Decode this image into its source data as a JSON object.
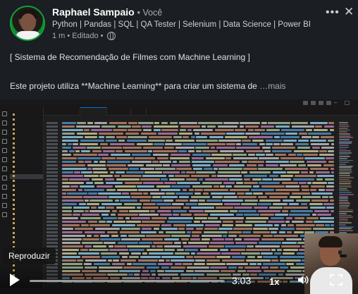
{
  "post": {
    "author_name": "Raphael Sampaio",
    "author_tag": "• Você",
    "headline": "Python | Pandas | SQL | QA Tester | Selenium | Data Science | Power BI",
    "time_edited": "1 m • Editado •",
    "text_line1": "[ Sistema de Recomendação de Filmes com Machine Learning ]",
    "text_line2": "Este projeto utiliza **Machine Learning** para criar um sistema de",
    "see_more": "…mais"
  },
  "icons": {
    "more": "more-icon",
    "close": "close-icon",
    "visibility": "globe-icon",
    "play": "play-icon",
    "volume": "volume-icon",
    "fullscreen": "fullscreen-icon"
  },
  "video": {
    "play_label": "Reproduzir",
    "duration": "3:03",
    "speed": "1x",
    "progress": 0.0
  }
}
